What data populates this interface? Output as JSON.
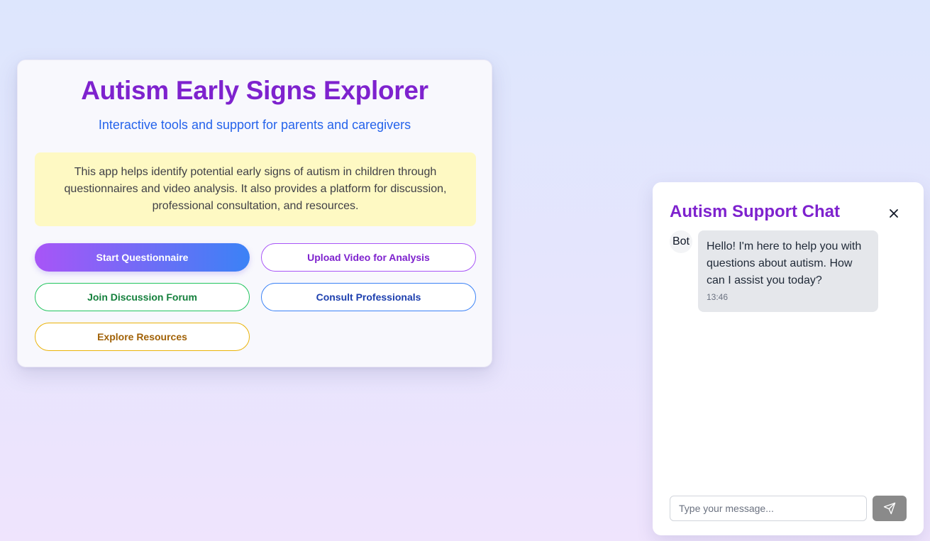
{
  "app": {
    "title": "Autism Early Signs Explorer",
    "subtitle": "Interactive tools and support for parents and caregivers",
    "description": "This app helps identify potential early signs of autism in children through questionnaires and video analysis. It also provides a platform for discussion, professional consultation, and resources."
  },
  "actions": {
    "start_questionnaire": "Start Questionnaire",
    "upload_video": "Upload Video for Analysis",
    "join_forum": "Join Discussion Forum",
    "consult_professionals": "Consult Professionals",
    "explore_resources": "Explore Resources"
  },
  "chat": {
    "title": "Autism Support Chat",
    "close_icon": "close-icon",
    "messages": [
      {
        "sender": "Bot",
        "text": "Hello! I'm here to help you with questions about autism. How can I assist you today?",
        "time": "13:46"
      }
    ],
    "input": {
      "value": "",
      "placeholder": "Type your message..."
    },
    "send_icon": "send-icon"
  },
  "colors": {
    "accent_purple": "#7e22ce",
    "accent_blue": "#2563eb",
    "info_bg": "#fef9c3",
    "gradient_start": "#a855f7",
    "gradient_end": "#3b82f6",
    "forum_green": "#15803d",
    "consult_navy": "#1e40af",
    "resources_amber": "#a16207",
    "send_button_gray": "#8a8a8a"
  }
}
